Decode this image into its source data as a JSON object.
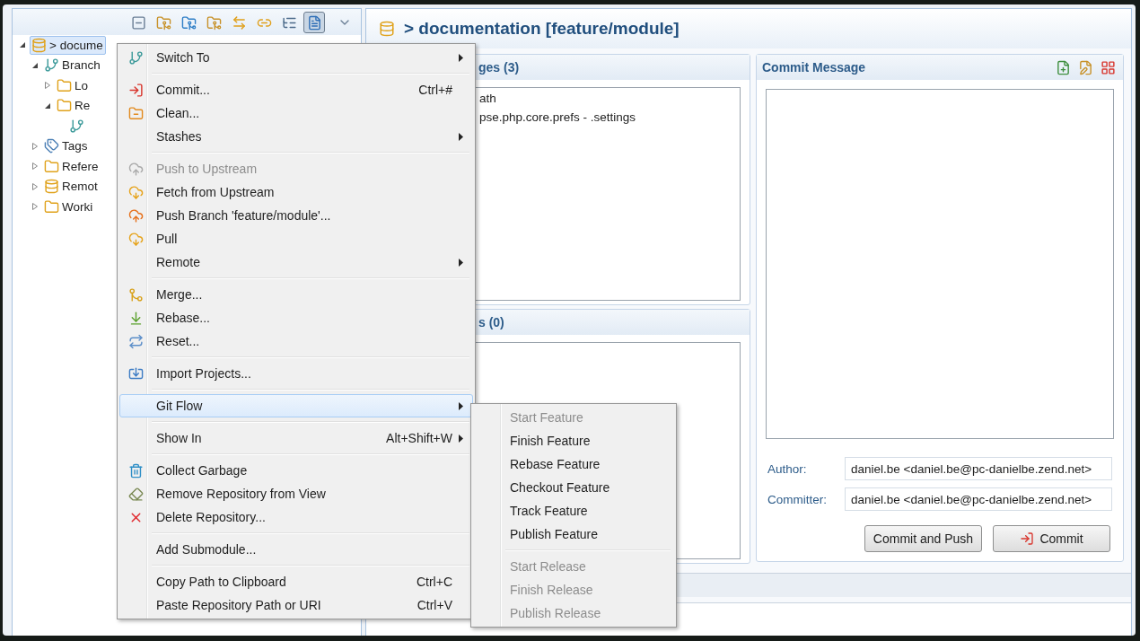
{
  "repositories": {
    "toolbar": [
      {
        "selected": false
      },
      {
        "selected": false
      },
      {
        "selected": false
      },
      {
        "selected": false
      },
      {
        "selected": false
      },
      {
        "selected": false
      },
      {
        "selected": false
      },
      {
        "selected": true
      }
    ],
    "tree": [
      {
        "kind": "repository",
        "label": "> docume",
        "selected": true,
        "expanded": true,
        "children": [
          {
            "kind": "branches",
            "label": "Branch",
            "selected": false,
            "expanded": true,
            "children": [
              {
                "kind": "folder",
                "label": "Lo",
                "selected": false,
                "expanded": false
              },
              {
                "kind": "folder",
                "label": "Re",
                "selected": false,
                "expanded": true,
                "children": [
                  {
                    "kind": "branch",
                    "selected": false
                  }
                ]
              }
            ]
          },
          {
            "kind": "tags",
            "label": "Tags",
            "selected": false,
            "expanded": false
          },
          {
            "kind": "folder",
            "label": "Refere",
            "selected": false,
            "expanded": false
          },
          {
            "kind": "remote",
            "label": "Remot",
            "selected": false,
            "expanded": false
          },
          {
            "kind": "folder",
            "label": "Worki",
            "selected": false,
            "expanded": false
          }
        ]
      }
    ]
  },
  "staging": {
    "title": "> documentation [feature/module]",
    "unstaged": {
      "title": "ges (3)",
      "files": [
        "ath",
        "pse.php.core.prefs - .settings"
      ]
    },
    "staged": {
      "title": "s (0)"
    },
    "commit_message": {
      "title": "Commit Message"
    },
    "author": {
      "label": "Author:",
      "value": "daniel.be <daniel.be@pc-danielbe.zend.net>"
    },
    "committer": {
      "label": "Committer:",
      "value": "daniel.be <daniel.be@pc-danielbe.zend.net>"
    },
    "buttons": [
      {
        "label": "Commit and Push",
        "kind": "plain"
      },
      {
        "label": "Commit",
        "kind": "commit"
      }
    ]
  },
  "context_menu": {
    "groups": [
      [
        {
          "label": "Switch To",
          "submenu": true,
          "disabled": false,
          "selected": false
        }
      ],
      [
        {
          "label": "Commit...",
          "shortcut": "Ctrl+#",
          "submenu": false,
          "disabled": false,
          "selected": false
        },
        {
          "label": "Clean...",
          "submenu": false,
          "disabled": false,
          "selected": false
        },
        {
          "label": "Stashes",
          "submenu": true,
          "disabled": false,
          "selected": false
        }
      ],
      [
        {
          "label": "Push to Upstream",
          "submenu": false,
          "disabled": true,
          "selected": false
        },
        {
          "label": "Fetch from Upstream",
          "submenu": false,
          "disabled": false,
          "selected": false
        },
        {
          "label": "Push Branch 'feature/module'...",
          "submenu": false,
          "disabled": false,
          "selected": false
        },
        {
          "label": "Pull",
          "submenu": false,
          "disabled": false,
          "selected": false
        },
        {
          "label": "Remote",
          "submenu": true,
          "disabled": false,
          "selected": false
        }
      ],
      [
        {
          "label": "Merge...",
          "submenu": false,
          "disabled": false,
          "selected": false
        },
        {
          "label": "Rebase...",
          "submenu": false,
          "disabled": false,
          "selected": false
        },
        {
          "label": "Reset...",
          "submenu": false,
          "disabled": false,
          "selected": false
        }
      ],
      [
        {
          "label": "Import Projects...",
          "submenu": false,
          "disabled": false,
          "selected": false
        }
      ],
      [
        {
          "label": "Git Flow",
          "submenu": true,
          "disabled": false,
          "selected": true
        }
      ],
      [
        {
          "label": "Show In",
          "shortcut": "Alt+Shift+W",
          "submenu": true,
          "disabled": false,
          "selected": false
        }
      ],
      [
        {
          "label": "Collect Garbage",
          "submenu": false,
          "disabled": false,
          "selected": false
        },
        {
          "label": "Remove Repository from View",
          "submenu": false,
          "disabled": false,
          "selected": false
        },
        {
          "label": "Delete Repository...",
          "submenu": false,
          "disabled": false,
          "selected": false
        }
      ],
      [
        {
          "label": "Add Submodule...",
          "submenu": false,
          "disabled": false,
          "selected": false
        }
      ],
      [
        {
          "label": "Copy Path to Clipboard",
          "shortcut": "Ctrl+C",
          "submenu": false,
          "disabled": false,
          "selected": false
        },
        {
          "label": "Paste Repository Path or URI",
          "shortcut": "Ctrl+V",
          "submenu": false,
          "disabled": false,
          "selected": false
        }
      ]
    ]
  },
  "git_flow_submenu": {
    "groups": [
      [
        {
          "label": "Start Feature",
          "disabled": true
        },
        {
          "label": "Finish Feature",
          "disabled": false
        },
        {
          "label": "Rebase Feature",
          "disabled": false
        },
        {
          "label": "Checkout Feature",
          "disabled": false
        },
        {
          "label": "Track Feature",
          "disabled": false
        },
        {
          "label": "Publish Feature",
          "disabled": false
        }
      ],
      [
        {
          "label": "Start Release",
          "disabled": true
        },
        {
          "label": "Finish Release",
          "disabled": true
        },
        {
          "label": "Publish Release",
          "disabled": true
        }
      ]
    ]
  }
}
